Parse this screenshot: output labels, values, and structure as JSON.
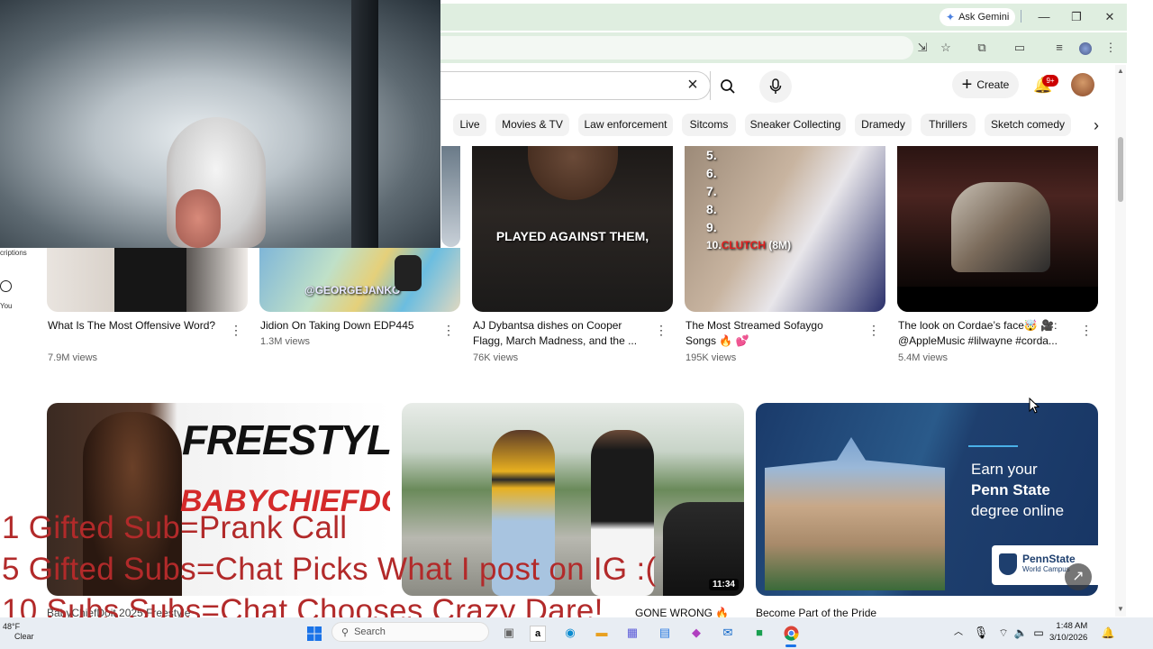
{
  "browser": {
    "ask_gemini": "Ask Gemini",
    "window_controls": [
      "minimize",
      "restore",
      "close"
    ],
    "toolbar_icons": [
      "install-icon",
      "bookmark-star-icon",
      "extensions-icon",
      "tab-search-icon",
      "media-controls-icon",
      "profile-icon",
      "more-icon"
    ]
  },
  "youtube": {
    "search_value": "",
    "create_label": "Create",
    "notifications_badge": "9+",
    "chips": [
      "Live",
      "Movies & TV",
      "Law enforcement",
      "Sitcoms",
      "Sneaker Collecting",
      "Dramedy",
      "Thrillers",
      "Sketch comedy"
    ],
    "sidebar": {
      "subscriptions_label": "criptions",
      "you_label": "You"
    },
    "row1": [
      {
        "title": "What Is The Most Offensive Word?",
        "views": "7.9M views"
      },
      {
        "title": "Jidion On Taking Down EDP445",
        "views": "1.3M views",
        "thumb_text": "@GEORGEJANKO"
      },
      {
        "title": "AJ Dybantsa dishes on Cooper Flagg, March Madness, and the ...",
        "views": "76K views",
        "thumb_text": "PLAYED AGAINST THEM,"
      },
      {
        "title": "The Most Streamed Sofaygo Songs 🔥 💕",
        "views": "195K views",
        "thumb_list": [
          "5.",
          "6.",
          "7.",
          "8.",
          "9."
        ],
        "thumb_last": "10.",
        "thumb_last_red": "CLUTCH",
        "thumb_last_tail": " (8M)"
      },
      {
        "title": "The look on Cordae’s face🤯 🎥: @AppleMusic #lilwayne #corda...",
        "views": "5.4M views"
      }
    ],
    "row2": [
      {
        "thumb_text_1": "FREESTYLE",
        "thumb_text_2": "BABYCHIEFDOIT",
        "partial_title": "BabyChiefDoit 2025 Freestyle"
      },
      {
        "duration": "11:34",
        "partial_title": "GONE WRONG 🔥"
      },
      {
        "ad_line1": "Earn your",
        "ad_line2": "Penn State",
        "ad_line3": "degree online",
        "ad_logo": "PennState",
        "ad_logo_sub": "World Campus",
        "partial_title": "Become Part of the Pride"
      }
    ]
  },
  "overlay": {
    "line1": "1 Gifted Sub=Prank Call",
    "line2": "5 Gifted Subs=Chat Picks What I post on IG :(",
    "line3": "10 Subs Subs=Chat Chooses Crazy Dare!"
  },
  "taskbar": {
    "weather_temp": "48°F",
    "weather_desc": "Clear",
    "search_label": "Search",
    "time": "1:48 AM",
    "date": "3/10/2026"
  },
  "colors": {
    "overlay_red": "#b22a2a",
    "chrome_green": "#dfeee0",
    "notif_red": "#cc0000"
  }
}
